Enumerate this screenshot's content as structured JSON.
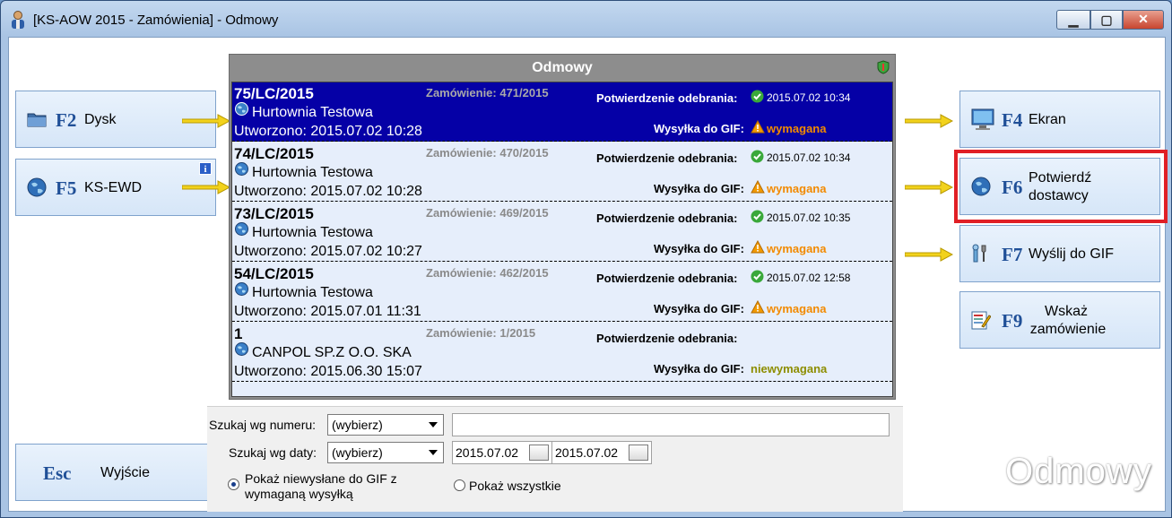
{
  "window": {
    "title": "[KS-AOW 2015 - Zamówienia] - Odmowy",
    "min_label": "▁",
    "max_label": "▢",
    "close_label": "✕"
  },
  "left_buttons": [
    {
      "key": "F2",
      "label": "Dysk",
      "icon": "folder-icon"
    },
    {
      "key": "F5",
      "label": "KS-EWD",
      "icon": "globe-icon",
      "badge": "i"
    }
  ],
  "exit_button": {
    "key": "Esc",
    "label": "Wyjście"
  },
  "right_buttons": [
    {
      "key": "F4",
      "label": "Ekran",
      "icon": "monitor-icon"
    },
    {
      "key": "F6",
      "label_line1": "Potwierdź",
      "label_line2": "dostawcy",
      "icon": "globe-icon"
    },
    {
      "key": "F7",
      "label": "Wyślij do GIF",
      "icon": "tools-icon"
    },
    {
      "key": "F9",
      "label_line1": "Wskaż",
      "label_line2": "zamówienie",
      "icon": "edit-form-icon"
    }
  ],
  "list": {
    "title": "Odmowy",
    "rows": [
      {
        "number": "75/LC/2015",
        "order": "Zamówienie: 471/2015",
        "supplier": "Hurtownia Testowa",
        "created": "Utworzono: 2015.07.02 10:28",
        "conf_label": "Potwierdzenie odebrania:",
        "conf_value": "2015.07.02 10:34",
        "gif_label": "Wysyłka do GIF:",
        "gif_value": "wymagana"
      },
      {
        "number": "74/LC/2015",
        "order": "Zamówienie: 470/2015",
        "supplier": "Hurtownia Testowa",
        "created": "Utworzono: 2015.07.02 10:28",
        "conf_label": "Potwierdzenie odebrania:",
        "conf_value": "2015.07.02 10:34",
        "gif_label": "Wysyłka do GIF:",
        "gif_value": "wymagana"
      },
      {
        "number": "73/LC/2015",
        "order": "Zamówienie: 469/2015",
        "supplier": "Hurtownia Testowa",
        "created": "Utworzono: 2015.07.02 10:27",
        "conf_label": "Potwierdzenie odebrania:",
        "conf_value": "2015.07.02 10:35",
        "gif_label": "Wysyłka do GIF:",
        "gif_value": "wymagana"
      },
      {
        "number": "54/LC/2015",
        "order": "Zamówienie: 462/2015",
        "supplier": "Hurtownia Testowa",
        "created": "Utworzono: 2015.07.01 11:31",
        "conf_label": "Potwierdzenie odebrania:",
        "conf_value": "2015.07.02 12:58",
        "gif_label": "Wysyłka do GIF:",
        "gif_value": "wymagana"
      },
      {
        "number": "1",
        "order": "Zamówienie: 1/2015",
        "supplier": "CANPOL SP.Z O.O. SKA",
        "created": "Utworzono: 2015.06.30 15:07",
        "conf_label": "Potwierdzenie odebrania:",
        "conf_value": "",
        "gif_label": "Wysyłka do GIF:",
        "gif_value": "niewymagana"
      }
    ]
  },
  "filters": {
    "by_number_label": "Szukaj wg numeru:",
    "by_number_select": "(wybierz)",
    "by_number_value": "",
    "by_date_label": "Szukaj wg daty:",
    "by_date_select": "(wybierz)",
    "date_from": "2015.07.02",
    "date_to": "2015.07.02",
    "radio1_line1": "Pokaż niewysłane do GIF z",
    "radio1_line2": "wymaganą wysyłką",
    "radio2": "Pokaż wszystkie"
  },
  "watermark": "Odmowy",
  "colors": {
    "accent": "#1f4f97",
    "selected_row": "#0500a6",
    "warning": "#f28a00",
    "highlight": "#e01f25"
  }
}
